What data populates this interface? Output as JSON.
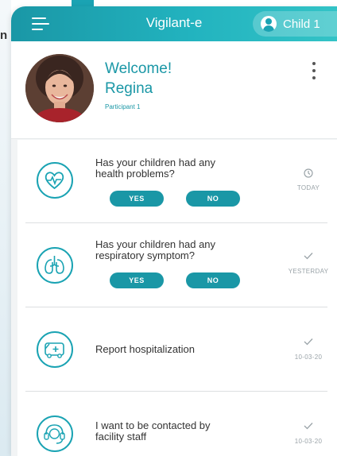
{
  "background_text": "n",
  "topbar": {
    "title": "Vigilant-e",
    "child_label": "Child 1",
    "menu_icon": "hamburger-menu-icon",
    "child_icon": "user-circle-icon"
  },
  "profile": {
    "welcome": "Welcome!",
    "name": "Regina",
    "role": "Participant 1",
    "more_icon": "more-vertical-icon"
  },
  "items": [
    {
      "question": "Has your children had any health problems?",
      "icon": "heart-pulse-icon",
      "yes_label": "YES",
      "no_label": "NO",
      "status_icon": "clock-icon",
      "status_text": "TODAY"
    },
    {
      "question": "Has your children had any respiratory symptom?",
      "icon": "lungs-icon",
      "yes_label": "YES",
      "no_label": "NO",
      "status_icon": "check-icon",
      "status_text": "YESTERDAY"
    },
    {
      "question": "Report hospitalization",
      "icon": "ambulance-icon",
      "status_icon": "check-icon",
      "status_text": "10-03-20"
    },
    {
      "question": "I want to be contacted by facility staff",
      "icon": "headset-icon",
      "status_icon": "check-icon",
      "status_text": "10-03-20"
    }
  ],
  "colors": {
    "accent": "#1aa3b3",
    "accent_dark": "#1a97a6",
    "status_gray": "#9aa3a8"
  }
}
